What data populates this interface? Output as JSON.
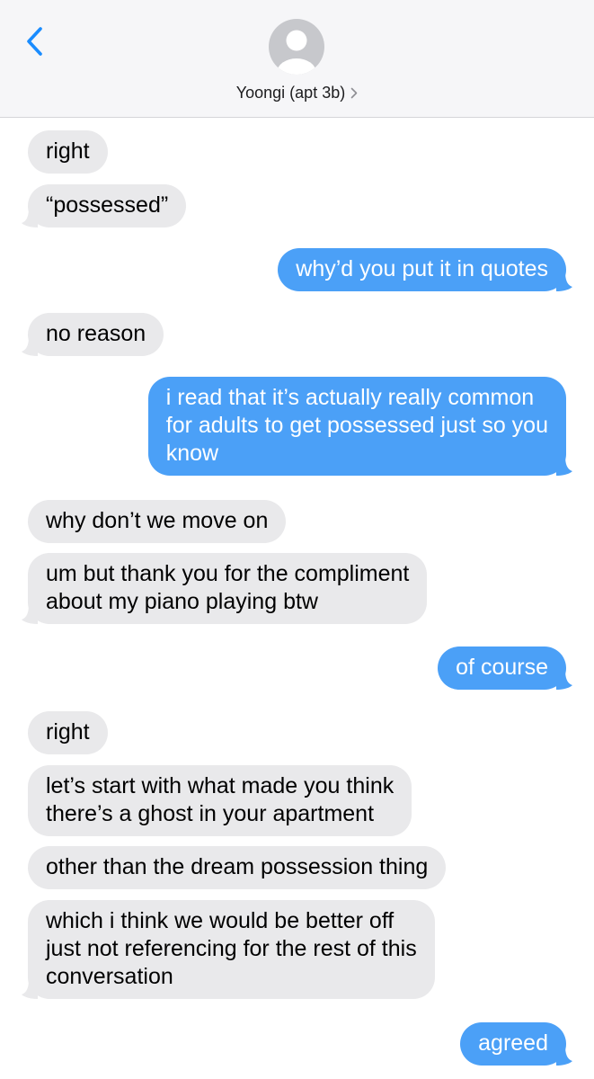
{
  "header": {
    "contact_name": "Yoongi (apt 3b)",
    "back_icon": "chevron-left-icon",
    "avatar_icon": "person-silhouette-icon",
    "details_icon": "chevron-right-icon"
  },
  "colors": {
    "incoming_bubble": "#e9e9eb",
    "outgoing_bubble": "#4ba0f7",
    "accent": "#1a8cff",
    "header_bg": "#f6f6f8"
  },
  "messages": [
    {
      "from": "them",
      "text": "right"
    },
    {
      "from": "them",
      "text": "“possessed”"
    },
    {
      "from": "me",
      "text": "why’d you put it in quotes"
    },
    {
      "from": "them",
      "text": "no reason"
    },
    {
      "from": "me",
      "lines": [
        "i read that it’s actually really common",
        "for adults to get possessed just so you",
        "know"
      ]
    },
    {
      "from": "them",
      "text": "why don’t we move on"
    },
    {
      "from": "them",
      "lines": [
        "um but thank you for the compliment",
        "about my piano playing btw"
      ]
    },
    {
      "from": "me",
      "text": "of course"
    },
    {
      "from": "them",
      "text": "right"
    },
    {
      "from": "them",
      "lines": [
        "let’s start with what made you think",
        "there’s a ghost in your apartment"
      ]
    },
    {
      "from": "them",
      "text": "other than the dream possession thing"
    },
    {
      "from": "them",
      "lines": [
        "which i think we would be better off",
        "just not referencing for the rest of this",
        "conversation"
      ]
    },
    {
      "from": "me",
      "text": "agreed"
    }
  ]
}
